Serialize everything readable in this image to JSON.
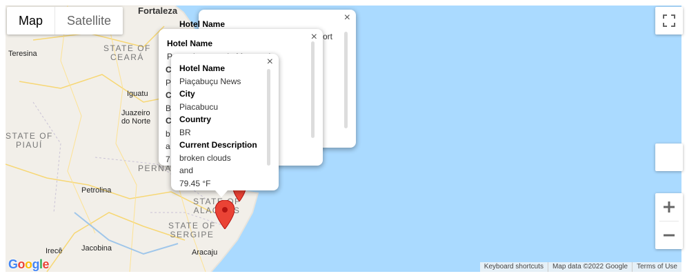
{
  "map": {
    "type_controls": {
      "map": "Map",
      "satellite": "Satellite"
    },
    "places": {
      "fortaleza": "Fortaleza",
      "teresina": "Teresina",
      "iguatu": "Iguatu",
      "juazeiro": "Juazeiro\ndo Norte",
      "petrolina": "Petrolina",
      "irece": "Irecê",
      "jacobina": "Jacobina",
      "aracaju": "Aracaju"
    },
    "states": {
      "ceara": "STATE OF\nCEARÁ",
      "piaui": "STATE OF\nPIAUÍ",
      "pernambuco": "PERNA",
      "alagoas": "STATE OF\nALAGOAS",
      "sergipe": "STATE OF\nSERGIPE"
    },
    "footer": {
      "shortcuts": "Keyboard shortcuts",
      "data": "Map data ©2022 Google",
      "terms": "Terms of Use"
    },
    "logo": "Google"
  },
  "infowindows": {
    "back": {
      "hotel_label": "Hotel Name",
      "hotel_partial": "ort"
    },
    "middle": {
      "hotel_label": "Hotel Name",
      "hotel_value": "Pousada enseada Maragogi",
      "partial_rows": [
        "C",
        "P",
        "C",
        "B",
        "C",
        "b",
        "a",
        "7"
      ]
    },
    "front": {
      "hotel_label": "Hotel Name",
      "hotel_value": "Piaçabuçu News",
      "city_label": "City",
      "city_value": "Piacabucu",
      "country_label": "Country",
      "country_value": "BR",
      "desc_label": "Current Description",
      "desc_value": "broken clouds",
      "and": "and",
      "temp": "79.45 °F"
    }
  },
  "colors": {
    "water": "#aadaff",
    "land": "#f2efe9",
    "marker": "#ea4335"
  }
}
